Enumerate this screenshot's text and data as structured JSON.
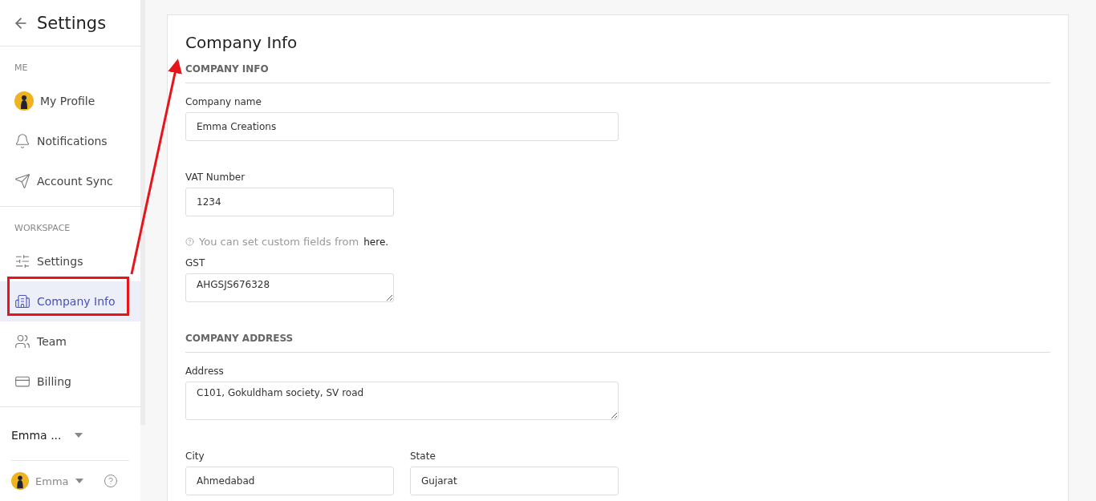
{
  "sidebar": {
    "title": "Settings",
    "sections": [
      {
        "heading": "ME",
        "items": [
          {
            "label": "My Profile",
            "selected": false
          },
          {
            "label": "Notifications",
            "selected": false
          },
          {
            "label": "Account Sync",
            "selected": false
          }
        ]
      },
      {
        "heading": "WORKSPACE",
        "items": [
          {
            "label": "Settings",
            "selected": false
          },
          {
            "label": "Company Info",
            "selected": true
          },
          {
            "label": "Team",
            "selected": false
          },
          {
            "label": "Billing",
            "selected": false
          }
        ]
      }
    ],
    "footer": {
      "workspace": "Emma ...",
      "user": "Emma"
    }
  },
  "content": {
    "title": "Company Info",
    "sections": [
      {
        "heading": "COMPANY INFO",
        "rows": [
          {
            "kind": "fields",
            "fields": [
              {
                "label": "Company name",
                "value": "Emma Creations",
                "kind": "input",
                "wide": true
              }
            ]
          },
          {
            "kind": "fields",
            "fields": [
              {
                "label": "VAT Number",
                "value": "1234",
                "kind": "input",
                "wide": false
              }
            ]
          },
          {
            "kind": "hint",
            "text": "You can set custom fields from",
            "link": "here."
          },
          {
            "kind": "fields",
            "fields": [
              {
                "label": "GST",
                "value": "AHGSJS676328",
                "kind": "textarea",
                "wide": false
              }
            ]
          }
        ]
      },
      {
        "heading": "COMPANY ADDRESS",
        "rows": [
          {
            "kind": "fields",
            "fields": [
              {
                "label": "Address",
                "value": "C101, Gokuldham society, SV road",
                "kind": "textarea",
                "wide": true
              }
            ]
          },
          {
            "kind": "fields",
            "fields": [
              {
                "label": "City",
                "value": "Ahmedabad",
                "kind": "input",
                "wide": false
              },
              {
                "label": "State",
                "value": "Gujarat",
                "kind": "input",
                "wide": false
              }
            ]
          }
        ]
      }
    ]
  }
}
